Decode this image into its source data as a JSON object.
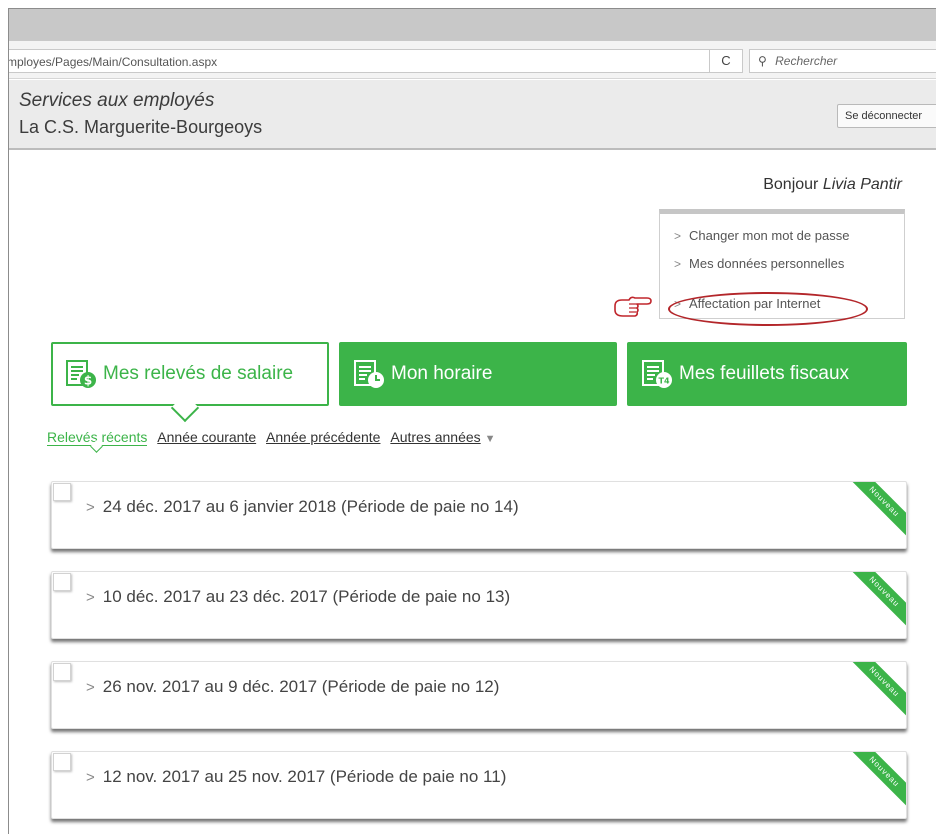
{
  "browser": {
    "url": "mployes/Pages/Main/Consultation.aspx",
    "reload_glyph": "C",
    "search_placeholder": "Rechercher",
    "search_icon": "search-icon"
  },
  "header": {
    "service_title": "Services aux employés",
    "organization": "La C.S. Marguerite-Bourgeoys",
    "logout_label": "Se déconnecter"
  },
  "greeting": {
    "prefix": "Bonjour",
    "user_name": "Livia Pantir"
  },
  "user_menu": {
    "items": [
      {
        "label": "Changer mon mot de passe"
      },
      {
        "label": "Mes données personnelles"
      },
      {
        "label": "Affectation par Internet"
      }
    ],
    "annotation_icon": "pointing-hand-icon",
    "highlight_color": "#b3262a"
  },
  "tiles": [
    {
      "label": "Mes relevés de salaire",
      "icon": "pay-stub-icon",
      "active": true
    },
    {
      "label": "Mon horaire",
      "icon": "schedule-icon",
      "active": false
    },
    {
      "label": "Mes feuillets fiscaux",
      "icon": "tax-slip-icon",
      "active": false
    }
  ],
  "tabs": {
    "items": [
      {
        "label": "Relevés récents",
        "active": true
      },
      {
        "label": "Année courante",
        "active": false
      },
      {
        "label": "Année précédente",
        "active": false
      },
      {
        "label": "Autres années",
        "active": false
      }
    ],
    "dropdown_glyph": "▼"
  },
  "pay_periods": [
    {
      "label": "24 déc. 2017 au 6 janvier 2018 (Période de paie no 14)",
      "badge": "Nouveau"
    },
    {
      "label": "10 déc. 2017 au 23 déc. 2017 (Période de paie no 13)",
      "badge": "Nouveau"
    },
    {
      "label": "26 nov. 2017 au 9 déc. 2017 (Période de paie no 12)",
      "badge": "Nouveau"
    },
    {
      "label": "12 nov. 2017 au 25 nov. 2017 (Période de paie no 11)",
      "badge": "Nouveau"
    }
  ],
  "colors": {
    "accent": "#3cb449",
    "header_bg": "#ebebeb"
  }
}
